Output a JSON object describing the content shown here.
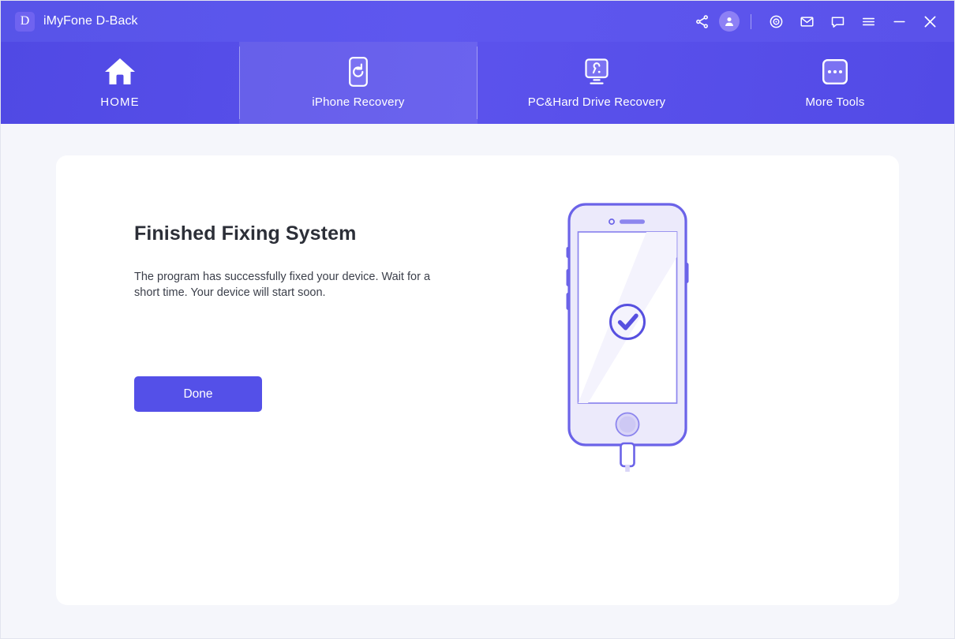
{
  "window": {
    "title": "iMyFone D-Back",
    "logo_letter": "D"
  },
  "titlebar": {
    "actions": [
      {
        "name": "share-icon",
        "label": "Share"
      },
      {
        "name": "account-icon",
        "label": "Account"
      },
      {
        "name": "target-icon",
        "label": "Register"
      },
      {
        "name": "mail-icon",
        "label": "Feedback"
      },
      {
        "name": "chat-icon",
        "label": "Support"
      },
      {
        "name": "menu-icon",
        "label": "Menu"
      },
      {
        "name": "minimize-icon",
        "label": "Minimize"
      },
      {
        "name": "close-icon",
        "label": "Close"
      }
    ]
  },
  "nav": {
    "tabs": [
      {
        "label": "HOME",
        "icon": "home-icon",
        "active": false
      },
      {
        "label": "iPhone Recovery",
        "icon": "phone-refresh-icon",
        "active": true
      },
      {
        "label": "PC&Hard Drive Recovery",
        "icon": "monitor-search-icon",
        "active": false
      },
      {
        "label": "More Tools",
        "icon": "more-dots-icon",
        "active": false
      }
    ]
  },
  "main": {
    "title": "Finished Fixing System",
    "description": "The program has successfully fixed your device. Wait for a short time. Your device will start soon.",
    "done_label": "Done",
    "illustration": {
      "name": "iphone-success-illustration",
      "status_icon": "check-circle-icon"
    }
  },
  "colors": {
    "accent": "#5450e8",
    "titlebar": "#5b54ee",
    "navbar": "#5650e8",
    "page_bg": "#f5f6fb",
    "card_bg": "#ffffff",
    "illustration": "#6b63e8",
    "heading_text": "#2c2f38"
  }
}
